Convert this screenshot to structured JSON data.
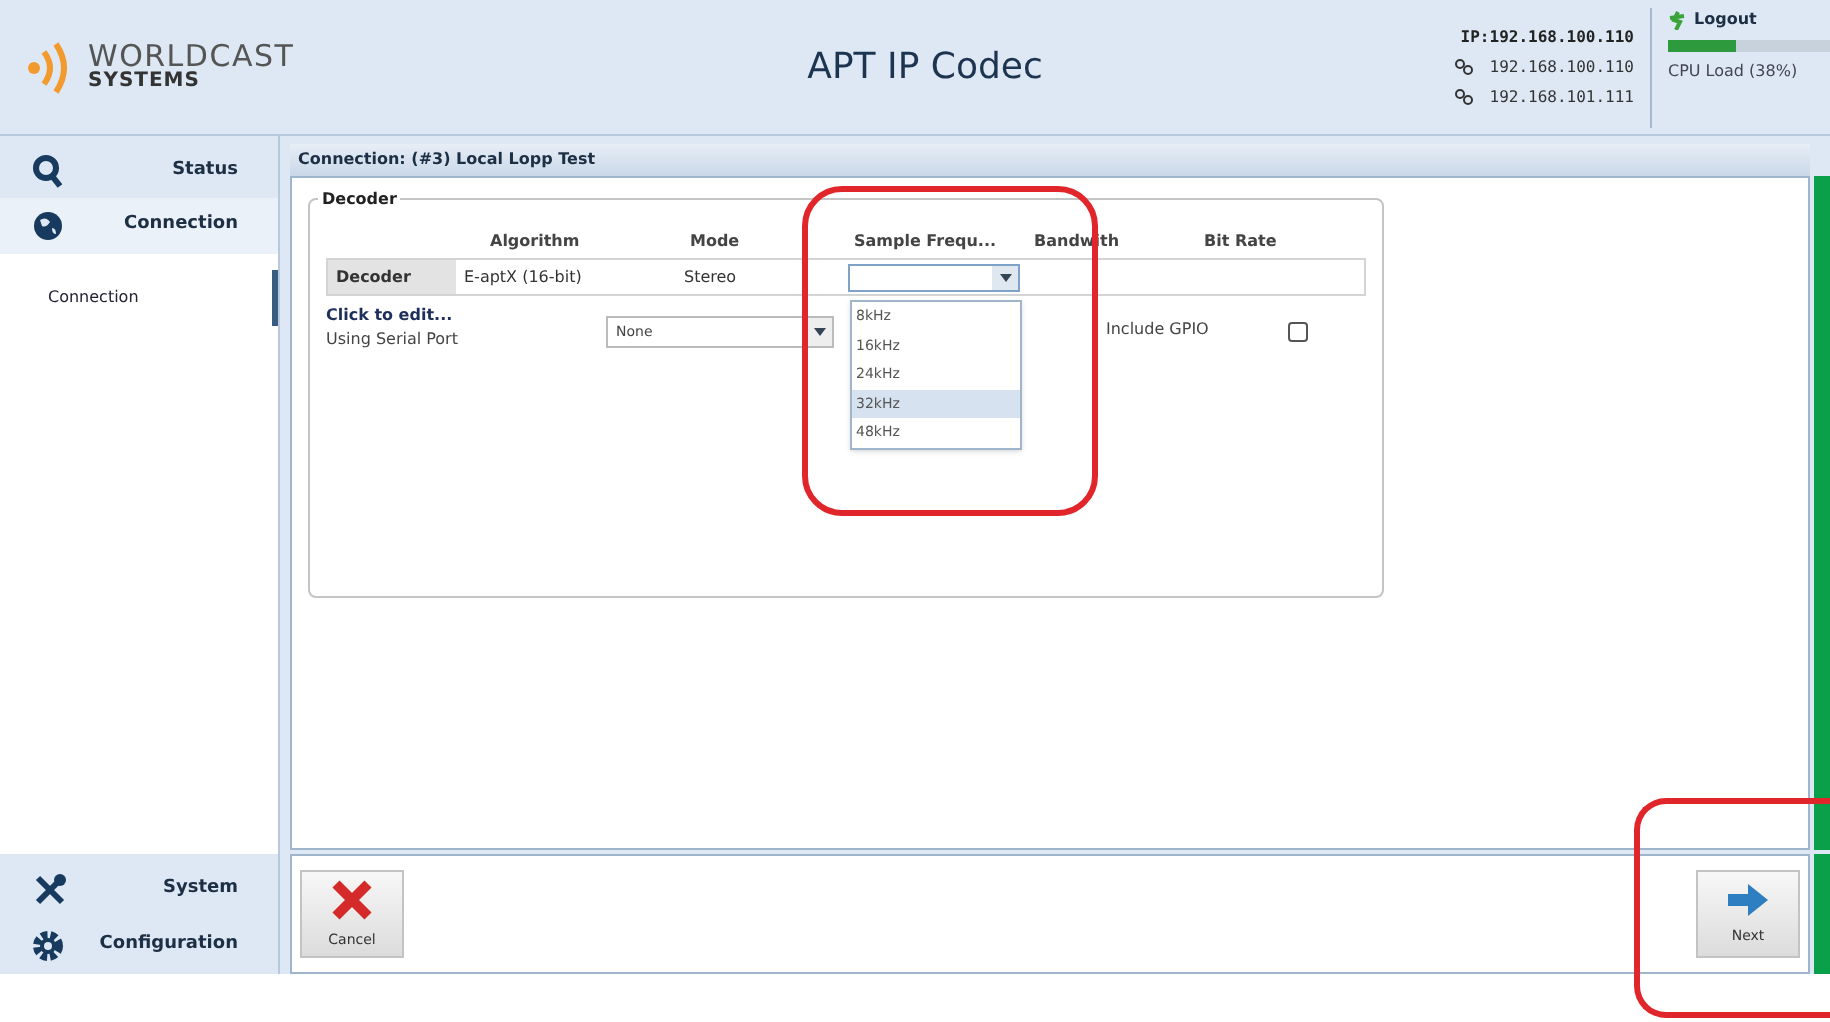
{
  "header": {
    "brand_top": "WORLDCAST",
    "brand_bottom": "SYSTEMS",
    "title": "APT IP Codec",
    "ip": "IP:192.168.100.110",
    "addresses": [
      "192.168.100.110",
      "192.168.101.111"
    ],
    "logout": "Logout",
    "cpu": {
      "reading": "CPU Load (38%)",
      "level": 0.38
    }
  },
  "sidebar": {
    "items": [
      {
        "label": "Status",
        "kind": "search",
        "selected": false
      },
      {
        "label": "Connection",
        "kind": "globe",
        "selected": true
      }
    ],
    "sub_items": [
      {
        "label": "Connection",
        "selected": true
      }
    ],
    "bottom_items": [
      {
        "label": "System",
        "kind": "tools",
        "selected": false
      },
      {
        "label": "Configuration",
        "kind": "gear",
        "selected": false
      }
    ]
  },
  "panel": {
    "title": "Connection: (#3) Local Lopp Test",
    "group": {
      "legend": "Decoder",
      "columns": [
        "Algorithm",
        "Mode",
        "Sample Frequ...",
        "Bandwith",
        "Bit Rate"
      ],
      "row": {
        "label": "Decoder",
        "algorithm": "E-aptX (16-bit)",
        "mode": "Stereo"
      },
      "sample_frequency": {
        "options": [
          {
            "label": "8kHz",
            "selected": false
          },
          {
            "label": "16kHz",
            "selected": false
          },
          {
            "label": "24kHz",
            "selected": false
          },
          {
            "label": "32kHz",
            "selected": true
          },
          {
            "label": "48kHz",
            "selected": false
          }
        ],
        "expanded": true
      },
      "edit_link": "Click to edit...",
      "serial_port_label": "Using Serial Port",
      "serial_port_value": "None",
      "gpio_label": "Include GPIO",
      "gpio_checked": false
    }
  },
  "footer": {
    "buttons": [
      {
        "label": "Cancel",
        "kind": "cancel"
      },
      {
        "label": "Next",
        "kind": "next"
      }
    ]
  }
}
